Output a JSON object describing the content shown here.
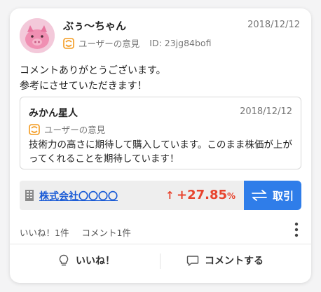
{
  "post": {
    "username": "ぶぅ〜ちゃん",
    "timestamp": "2018/12/12",
    "opinion_label": "ユーザーの意見",
    "user_id": "ID: 23jg84bofi",
    "body": "コメントありがとうございます。\n参考にさせていただきます！"
  },
  "quoted": {
    "username": "みかん星人",
    "timestamp": "2018/12/12",
    "opinion_label": "ユーザーの意見",
    "body": "技術力の高さに期待して購入しています。このまま株価が上がってくれることを期待しています！"
  },
  "stock": {
    "company": "株式会社〇〇〇〇",
    "arrow": "↑",
    "change": "+27.85",
    "unit": "%",
    "trade_label": "取引"
  },
  "stats": {
    "likes": "いいね！1件",
    "comments": "コメント1件"
  },
  "actions": {
    "like_label": "いいね！",
    "comment_label": "コメントする"
  },
  "colors": {
    "accent_blue": "#2f7de9",
    "link_blue": "#1a5bd6",
    "gain_red": "#e8442e",
    "opinion_orange": "#f39a1e"
  }
}
